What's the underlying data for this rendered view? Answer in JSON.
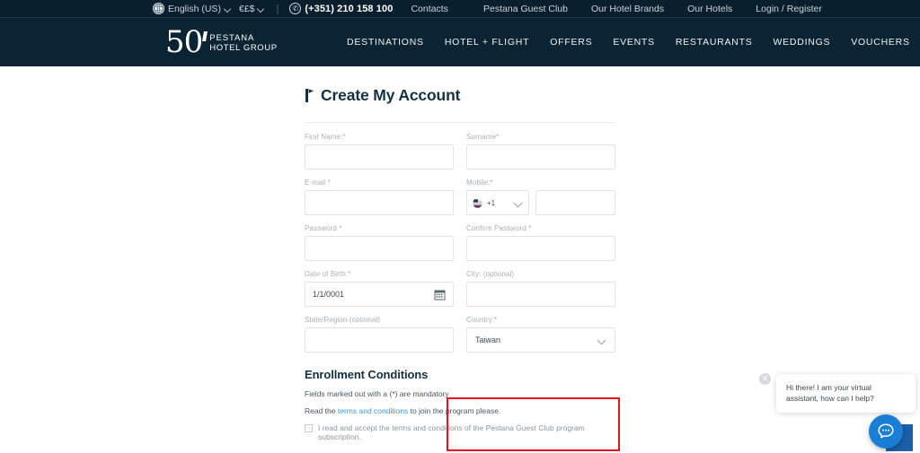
{
  "topbar": {
    "globe_icon": "globe-icon",
    "language": "English (US)",
    "currency": "€£$",
    "separator": "|",
    "phone_icon": "phone-icon",
    "phone": "(+351) 210 158 100",
    "contacts": "Contacts",
    "links": [
      {
        "label": "Pestana Guest Club"
      },
      {
        "label": "Our Hotel Brands"
      },
      {
        "label": "Our Hotels"
      },
      {
        "label": "Login / Register"
      }
    ]
  },
  "header": {
    "logo_number": "50",
    "logo_line1": "PESTANA",
    "logo_line2": "HOTEL GROUP",
    "nav": [
      {
        "label": "DESTINATIONS"
      },
      {
        "label": "HOTEL + FLIGHT"
      },
      {
        "label": "OFFERS"
      },
      {
        "label": "EVENTS"
      },
      {
        "label": "RESTAURANTS"
      },
      {
        "label": "WEDDINGS"
      },
      {
        "label": "VOUCHERS"
      }
    ]
  },
  "form": {
    "title": "Create My Account",
    "title_icon": "flag-icon",
    "first_name": {
      "label": "First Name:*",
      "value": ""
    },
    "surname": {
      "label": "Surname*",
      "value": ""
    },
    "email": {
      "label": "E-mail *",
      "value": ""
    },
    "mobile": {
      "label": "Mobile:*",
      "country_flag_icon": "country-flag-icon",
      "country_code": "+1",
      "number": ""
    },
    "password": {
      "label": "Password *",
      "value": ""
    },
    "confirm_password": {
      "label": "Confirm Password *",
      "value": ""
    },
    "date_of_birth": {
      "label": "Date of Birth:*",
      "value": "1/1/0001",
      "icon": "calendar-icon"
    },
    "city": {
      "label": "City: (optional)",
      "value": ""
    },
    "state_region": {
      "label": "State/Region (optional)",
      "value": ""
    },
    "country": {
      "label": "Country:*",
      "value": "Taiwan",
      "icon": "chevron-down-icon"
    }
  },
  "enrollment": {
    "title": "Enrollment Conditions",
    "mandatory_note": "Fields marked out with a (*) are mandatory",
    "terms_prefix": "Read the ",
    "terms_link": "terms and conditions",
    "terms_suffix": " to join the program please.",
    "checkbox_label": "I read and accept the terms and conditions of the Pestana Guest Club program subscription."
  },
  "chat": {
    "close_icon": "close-icon",
    "message": "Hi there! I am your virtual assistant, how can I help?",
    "button_icon": "chat-bubble-icon"
  },
  "annotation": {
    "highlight_color": "#e81123",
    "target": "country-select"
  },
  "colors": {
    "topbar_bg": "#0a1f2e",
    "header_bg": "#0a2433",
    "title_color": "#15303f",
    "link_blue": "#3d9bd1",
    "chat_blue": "#1a7fd4"
  }
}
